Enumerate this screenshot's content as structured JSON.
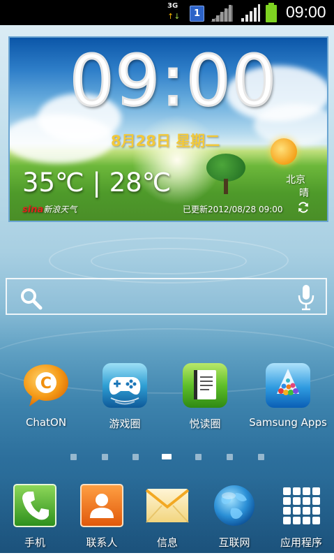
{
  "status_bar": {
    "network_type": "3G",
    "sim_slot": "1",
    "time": "09:00",
    "icons": [
      "data-activity-icon",
      "sim-card-icon",
      "signal-strength-icon",
      "signal-strength-icon",
      "battery-icon"
    ]
  },
  "weather_widget": {
    "time": "09:00",
    "date": "8月28日 星期二",
    "temperature": "35℃ | 28℃",
    "city": "北京",
    "condition": "晴",
    "provider_brand": "sina",
    "provider_name": "新浪天气",
    "updated": "已更新2012/08/28 09:00",
    "icons": [
      "sun-icon",
      "refresh-icon"
    ]
  },
  "search": {
    "icons": [
      "search-icon",
      "microphone-icon"
    ]
  },
  "apps": [
    {
      "label": "ChatON",
      "icon": "chaton-icon"
    },
    {
      "label": "游戏圈",
      "icon": "game-controller-icon"
    },
    {
      "label": "悦读圈",
      "icon": "book-icon"
    },
    {
      "label": "Samsung Apps",
      "icon": "samsung-apps-icon"
    }
  ],
  "page_indicator": {
    "total": 7,
    "current": 4
  },
  "dock": [
    {
      "label": "手机",
      "icon": "phone-icon"
    },
    {
      "label": "联系人",
      "icon": "contacts-icon"
    },
    {
      "label": "信息",
      "icon": "messages-icon"
    },
    {
      "label": "互联网",
      "icon": "internet-globe-icon"
    },
    {
      "label": "应用程序",
      "icon": "app-grid-icon"
    }
  ],
  "colors": {
    "status_bar": "#000000",
    "date_text": "#f2c93a",
    "sim_badge": "#2c63c8",
    "battery": "#7ed321"
  }
}
